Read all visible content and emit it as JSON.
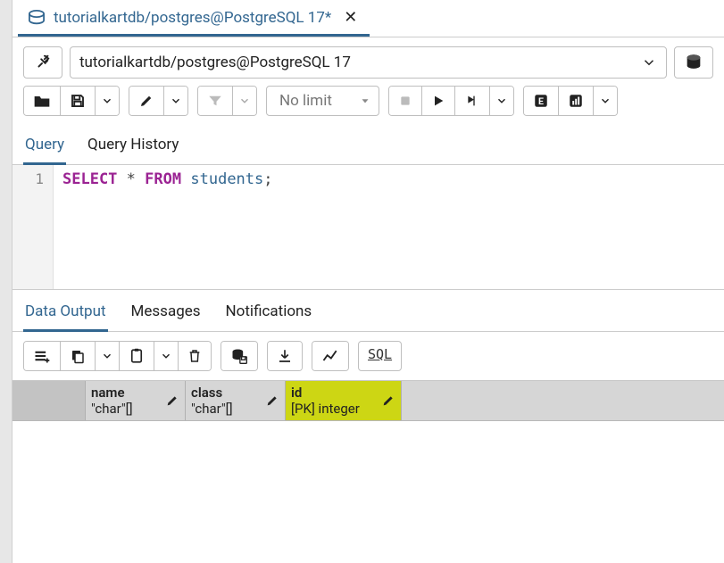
{
  "tab": {
    "title": "tutorialkartdb/postgres@PostgreSQL 17*"
  },
  "connection": {
    "value": "tutorialkartdb/postgres@PostgreSQL 17"
  },
  "limit": {
    "label": "No limit"
  },
  "sub_tabs": {
    "query": "Query",
    "history": "Query History"
  },
  "sql": {
    "select": "SELECT",
    "star": "*",
    "from": "FROM",
    "table": "students",
    "semi": ";"
  },
  "output_tabs": {
    "data": "Data Output",
    "messages": "Messages",
    "notifications": "Notifications"
  },
  "sql_button": "SQL",
  "grid": {
    "columns": [
      {
        "name": "name",
        "type": "\"char\"[]",
        "highlight": false
      },
      {
        "name": "class",
        "type": "\"char\"[]",
        "highlight": false
      },
      {
        "name": "id",
        "type": "[PK] integer",
        "highlight": true
      }
    ]
  },
  "line_number": "1"
}
